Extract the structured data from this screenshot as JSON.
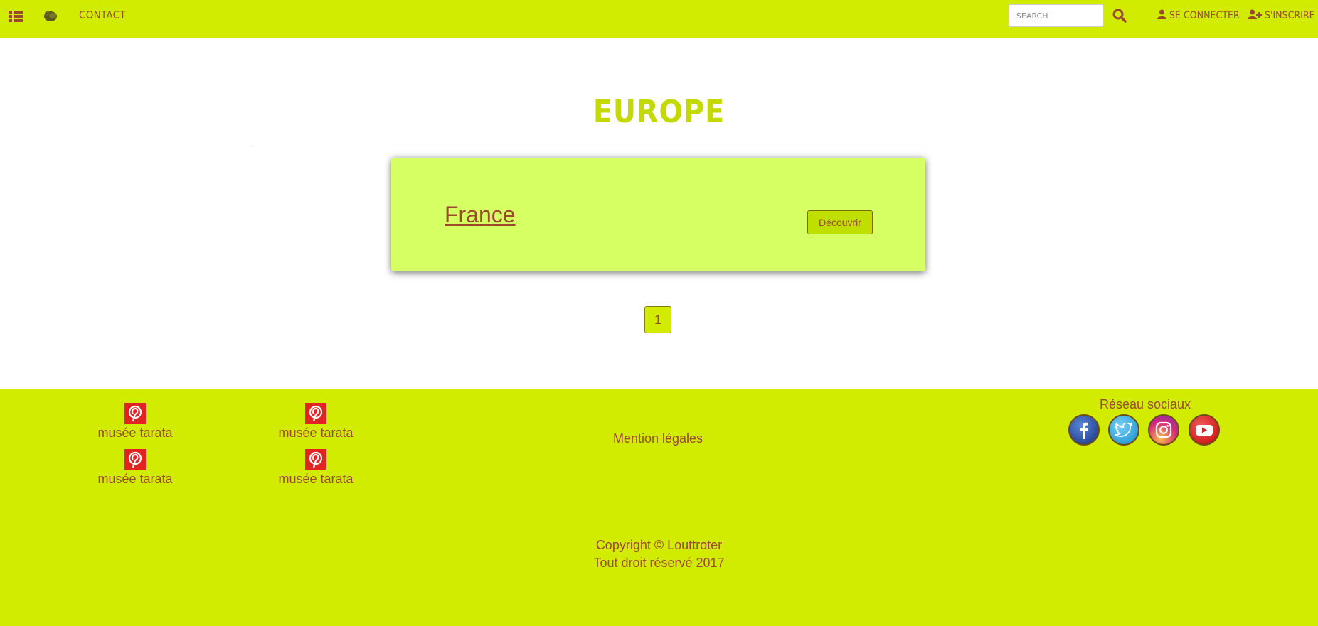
{
  "navbar": {
    "menu_icon": "list-icon",
    "logo_icon": "animal-logo-icon",
    "contact_label": "Contact",
    "search_placeholder": "Search",
    "search_icon": "search-icon",
    "login_label": "Se connecter",
    "login_icon": "user-icon",
    "register_label": "S'inscrire",
    "register_icon": "user-plus-icon"
  },
  "main": {
    "title": "Europe",
    "card": {
      "country": "France",
      "button_label": "Découvrir"
    },
    "pagination": {
      "current_page": "1"
    }
  },
  "footer": {
    "pinterest_items": [
      {
        "icon": "pinterest-icon",
        "label": "musée tarata"
      },
      {
        "icon": "pinterest-icon",
        "label": "musée tarata"
      },
      {
        "icon": "pinterest-icon",
        "label": "musée tarata"
      },
      {
        "icon": "pinterest-icon",
        "label": "musée tarata"
      }
    ],
    "legal_label": "Mention légales",
    "social_title": "Réseau sociaux",
    "social_icons": [
      "facebook-icon",
      "twitter-icon",
      "instagram-icon",
      "youtube-icon"
    ],
    "copyright_line1": "Copyright © Louttroter",
    "copyright_line2": "Tout droit réservé 2017"
  },
  "colors": {
    "brand_green": "#d1ec00",
    "card_green": "#d6ff63",
    "text_brown": "#9a4a2c",
    "title_green": "#c4d900",
    "pinterest_red": "#e32322"
  }
}
